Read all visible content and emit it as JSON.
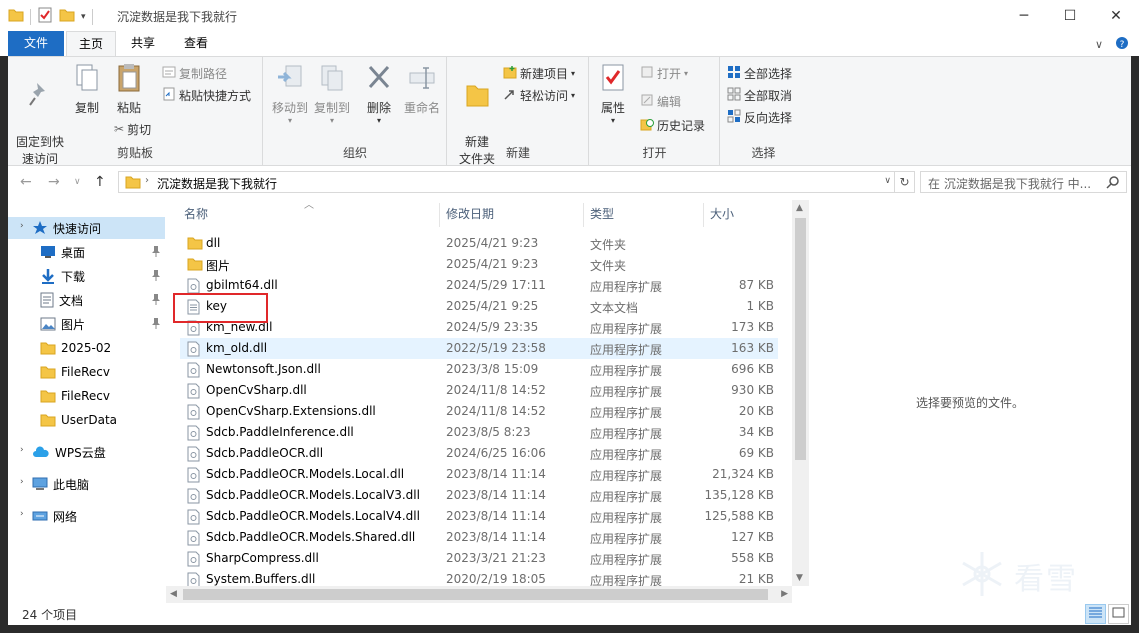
{
  "window": {
    "title": "沉淀数据是我下我就行"
  },
  "ribbon": {
    "tabs": [
      "文件",
      "主页",
      "共享",
      "查看"
    ],
    "groups": {
      "clipboard": {
        "label": "剪贴板",
        "pin": "固定到快\n速访问",
        "copy": "复制",
        "paste": "粘贴",
        "copy_path": "复制路径",
        "paste_shortcut": "粘贴快捷方式",
        "cut": "剪切"
      },
      "organize": {
        "label": "组织",
        "move_to": "移动到",
        "copy_to": "复制到",
        "delete": "删除",
        "rename": "重命名"
      },
      "new": {
        "label": "新建",
        "new_folder": "新建\n文件夹",
        "new_item": "新建项目",
        "easy_access": "轻松访问"
      },
      "open": {
        "label": "打开",
        "properties": "属性",
        "open": "打开",
        "edit": "编辑",
        "history": "历史记录"
      },
      "select": {
        "label": "选择",
        "select_all": "全部选择",
        "select_none": "全部取消",
        "invert": "反向选择"
      }
    }
  },
  "address": {
    "path": "沉淀数据是我下我就行",
    "search_placeholder": "在 沉淀数据是我下我就行 中..."
  },
  "nav": {
    "items": [
      {
        "label": "快速访问",
        "icon": "star-icon",
        "pinned": false,
        "selected": true
      },
      {
        "label": "桌面",
        "icon": "desktop-icon",
        "pinned": true,
        "selected": false
      },
      {
        "label": "下载",
        "icon": "download-icon",
        "pinned": true,
        "selected": false
      },
      {
        "label": "文档",
        "icon": "document-icon",
        "pinned": true,
        "selected": false
      },
      {
        "label": "图片",
        "icon": "pictures-icon",
        "pinned": true,
        "selected": false
      },
      {
        "label": "2025-02",
        "icon": "folder-icon",
        "pinned": false,
        "selected": false
      },
      {
        "label": "FileRecv",
        "icon": "folder-icon",
        "pinned": false,
        "selected": false
      },
      {
        "label": "FileRecv",
        "icon": "folder-icon",
        "pinned": false,
        "selected": false
      },
      {
        "label": "UserData",
        "icon": "folder-icon",
        "pinned": false,
        "selected": false
      },
      {
        "label": "WPS云盘",
        "icon": "cloud-icon",
        "pinned": false,
        "selected": false
      },
      {
        "label": "此电脑",
        "icon": "computer-icon",
        "pinned": false,
        "selected": false
      },
      {
        "label": "网络",
        "icon": "network-icon",
        "pinned": false,
        "selected": false
      }
    ]
  },
  "list": {
    "columns": {
      "name": "名称",
      "date": "修改日期",
      "type": "类型",
      "size": "大小"
    },
    "files": [
      {
        "name": "dll",
        "date": "2025/4/21 9:23",
        "type": "文件夹",
        "size": "",
        "kind": "folder"
      },
      {
        "name": "图片",
        "date": "2025/4/21 9:23",
        "type": "文件夹",
        "size": "",
        "kind": "folder"
      },
      {
        "name": "gbilmt64.dll",
        "date": "2024/5/29 17:11",
        "type": "应用程序扩展",
        "size": "87 KB",
        "kind": "dll"
      },
      {
        "name": "key",
        "date": "2025/4/21 9:25",
        "type": "文本文档",
        "size": "1 KB",
        "kind": "txt"
      },
      {
        "name": "km_new.dll",
        "date": "2024/5/9 23:35",
        "type": "应用程序扩展",
        "size": "173 KB",
        "kind": "dll"
      },
      {
        "name": "km_old.dll",
        "date": "2022/5/19 23:58",
        "type": "应用程序扩展",
        "size": "163 KB",
        "kind": "dll"
      },
      {
        "name": "Newtonsoft.Json.dll",
        "date": "2023/3/8 15:09",
        "type": "应用程序扩展",
        "size": "696 KB",
        "kind": "dll"
      },
      {
        "name": "OpenCvSharp.dll",
        "date": "2024/11/8 14:52",
        "type": "应用程序扩展",
        "size": "930 KB",
        "kind": "dll"
      },
      {
        "name": "OpenCvSharp.Extensions.dll",
        "date": "2024/11/8 14:52",
        "type": "应用程序扩展",
        "size": "20 KB",
        "kind": "dll"
      },
      {
        "name": "Sdcb.PaddleInference.dll",
        "date": "2023/8/5 8:23",
        "type": "应用程序扩展",
        "size": "34 KB",
        "kind": "dll"
      },
      {
        "name": "Sdcb.PaddleOCR.dll",
        "date": "2024/6/25 16:06",
        "type": "应用程序扩展",
        "size": "69 KB",
        "kind": "dll"
      },
      {
        "name": "Sdcb.PaddleOCR.Models.Local.dll",
        "date": "2023/8/14 11:14",
        "type": "应用程序扩展",
        "size": "21,324 KB",
        "kind": "dll"
      },
      {
        "name": "Sdcb.PaddleOCR.Models.LocalV3.dll",
        "date": "2023/8/14 11:14",
        "type": "应用程序扩展",
        "size": "135,128 KB",
        "kind": "dll"
      },
      {
        "name": "Sdcb.PaddleOCR.Models.LocalV4.dll",
        "date": "2023/8/14 11:14",
        "type": "应用程序扩展",
        "size": "125,588 KB",
        "kind": "dll"
      },
      {
        "name": "Sdcb.PaddleOCR.Models.Shared.dll",
        "date": "2023/8/14 11:14",
        "type": "应用程序扩展",
        "size": "127 KB",
        "kind": "dll"
      },
      {
        "name": "SharpCompress.dll",
        "date": "2023/3/21 21:23",
        "type": "应用程序扩展",
        "size": "558 KB",
        "kind": "dll"
      },
      {
        "name": "System.Buffers.dll",
        "date": "2020/2/19 18:05",
        "type": "应用程序扩展",
        "size": "21 KB",
        "kind": "dll"
      }
    ],
    "highlighted_index": 5
  },
  "preview": {
    "text": "选择要预览的文件。"
  },
  "status": {
    "count": "24 个项目"
  },
  "watermark": {
    "text": "看雪"
  },
  "colors": {
    "accent": "#1e6dc4",
    "selection": "#cce4f7",
    "hover": "#e5f3ff",
    "folder": "#f4c546",
    "annotation": "#e0282a"
  }
}
